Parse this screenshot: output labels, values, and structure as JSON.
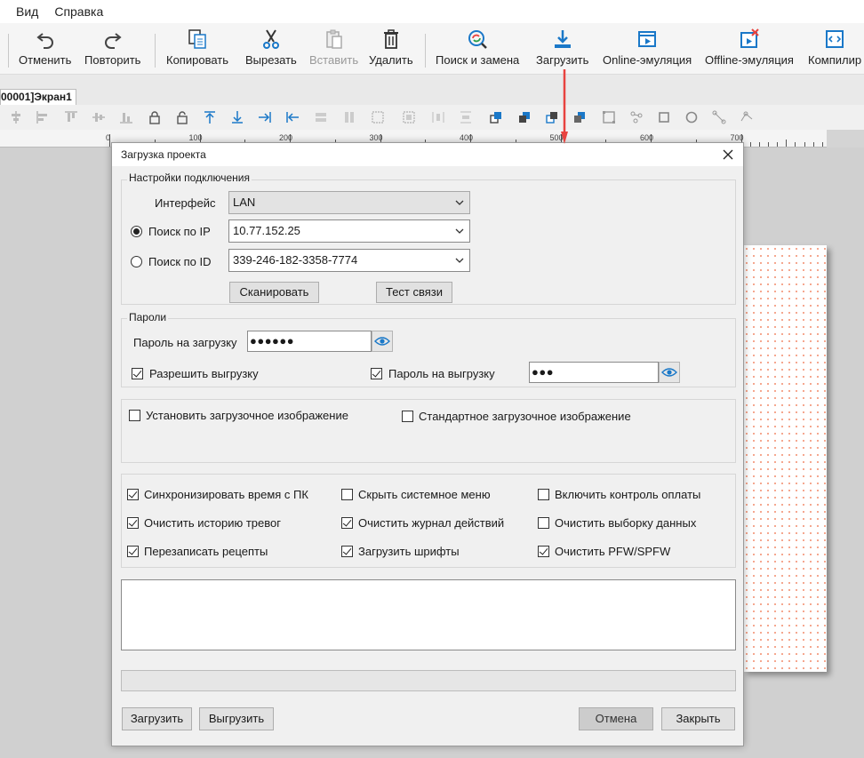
{
  "menu": [
    "Вид",
    "Справка"
  ],
  "toolbar": {
    "undo": "Отменить",
    "redo": "Повторить",
    "copy": "Копировать",
    "cut": "Вырезать",
    "paste": "Вставить",
    "delete": "Удалить",
    "find_replace": "Поиск и замена",
    "download": "Загрузить",
    "online_emulation": "Online-эмуляция",
    "offline_emulation": "Offline-эмуляция",
    "compile": "Компилир"
  },
  "screen_tab": "00001]Экран1",
  "ruler_labels": [
    "0",
    "100",
    "200",
    "300",
    "400",
    "500",
    "600",
    "700"
  ],
  "dialog": {
    "title": "Загрузка проекта",
    "connection": {
      "title": "Настройки подключения",
      "interface_label": "Интерфейс",
      "interface_value": "LAN",
      "search_ip_label": "Поиск по IP",
      "ip_value": "10.77.152.25",
      "search_id_label": "Поиск по ID",
      "id_value": "339-246-182-3358-7774",
      "scan_button": "Сканировать",
      "test_button": "Тест связи"
    },
    "passwords": {
      "title": "Пароли",
      "download_label": "Пароль на загрузку",
      "download_value": "●●●●●●",
      "allow_upload_label": "Разрешить выгрузку",
      "upload_pwd_label": "Пароль на выгрузку",
      "upload_value": "●●●"
    },
    "boot_image": {
      "set_label": "Установить загрузочное изображение",
      "standard_label": "Стандартное загрузочное изображение"
    },
    "options": [
      {
        "label": "Синхронизировать время с ПК",
        "checked": true
      },
      {
        "label": "Скрыть системное меню",
        "checked": false
      },
      {
        "label": "Включить контроль оплаты",
        "checked": false
      },
      {
        "label": "Очистить историю тревог",
        "checked": true
      },
      {
        "label": "Очистить журнал действий",
        "checked": true
      },
      {
        "label": "Очистить выборку данных",
        "checked": false
      },
      {
        "label": "Перезаписать рецепты",
        "checked": true
      },
      {
        "label": "Загрузить шрифты",
        "checked": true
      },
      {
        "label": "Очистить PFW/SPFW",
        "checked": true
      }
    ],
    "buttons": {
      "download": "Загрузить",
      "upload": "Выгрузить",
      "cancel": "Отмена",
      "close": "Закрыть"
    }
  },
  "colors": {
    "accent_arrow": "#e8433f",
    "icon_blue": "#1a78c8",
    "icon_dark": "#444444"
  }
}
